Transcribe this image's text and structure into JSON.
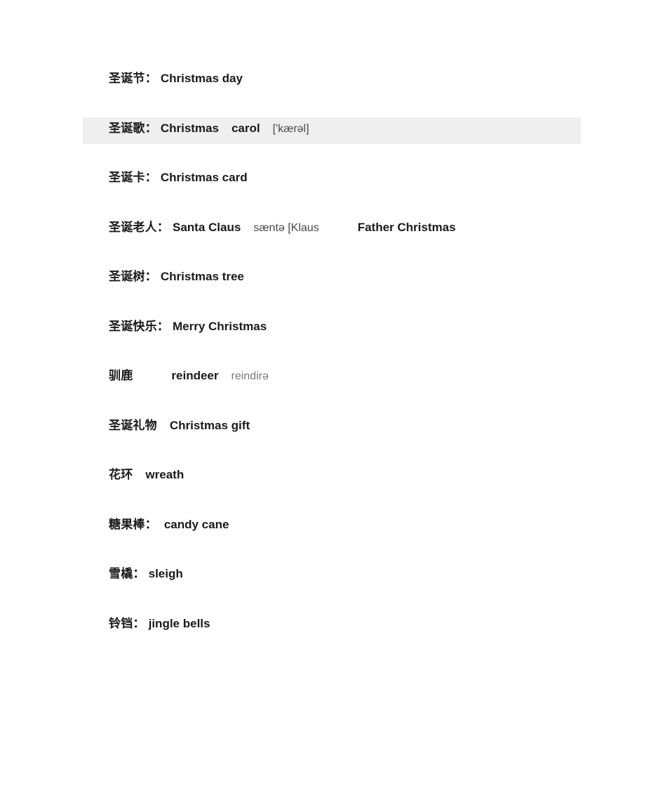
{
  "document": {
    "background_color": "#ffffff",
    "text_color": "#1a1a1a",
    "highlight_color": "#efefef",
    "phonetic_color": "#4a4a4a",
    "phonetic_light_color": "#7a7a7a"
  },
  "rows": [
    {
      "cn": "圣诞节：",
      "en": "Christmas day",
      "phonetic": "",
      "extra": "",
      "highlighted": false
    },
    {
      "cn": "圣诞歌：",
      "en": "Christmas",
      "en2": "carol",
      "phonetic": "['kærəl]",
      "extra": "",
      "highlighted": true
    },
    {
      "cn": "圣诞卡：",
      "en": "Christmas card",
      "phonetic": "",
      "extra": "",
      "highlighted": false
    },
    {
      "cn": "圣诞老人：",
      "en": "Santa Claus",
      "phonetic": "sæntə [Klaus",
      "extra": "Father Christmas",
      "highlighted": false
    },
    {
      "cn": "圣诞树：",
      "en": "Christmas tree",
      "phonetic": "",
      "extra": "",
      "highlighted": false
    },
    {
      "cn": "圣诞快乐：",
      "en": "Merry Christmas",
      "phonetic": "",
      "extra": "",
      "highlighted": false
    },
    {
      "cn": "驯鹿",
      "en": "reindeer",
      "phonetic": "reindirə",
      "extra": "",
      "highlighted": false
    },
    {
      "cn": "圣诞礼物",
      "en": "Christmas gift",
      "phonetic": "",
      "extra": "",
      "highlighted": false
    },
    {
      "cn": "花环",
      "en": "wreath",
      "phonetic": "",
      "extra": "",
      "highlighted": false
    },
    {
      "cn": "糖果棒：",
      "en": "candy cane",
      "phonetic": "",
      "extra": "",
      "highlighted": false
    },
    {
      "cn": "雪橇：",
      "en": "sleigh",
      "phonetic": "",
      "extra": "",
      "highlighted": false
    },
    {
      "cn": "铃铛：",
      "en": "jingle bells",
      "phonetic": "",
      "extra": "",
      "highlighted": false
    }
  ]
}
